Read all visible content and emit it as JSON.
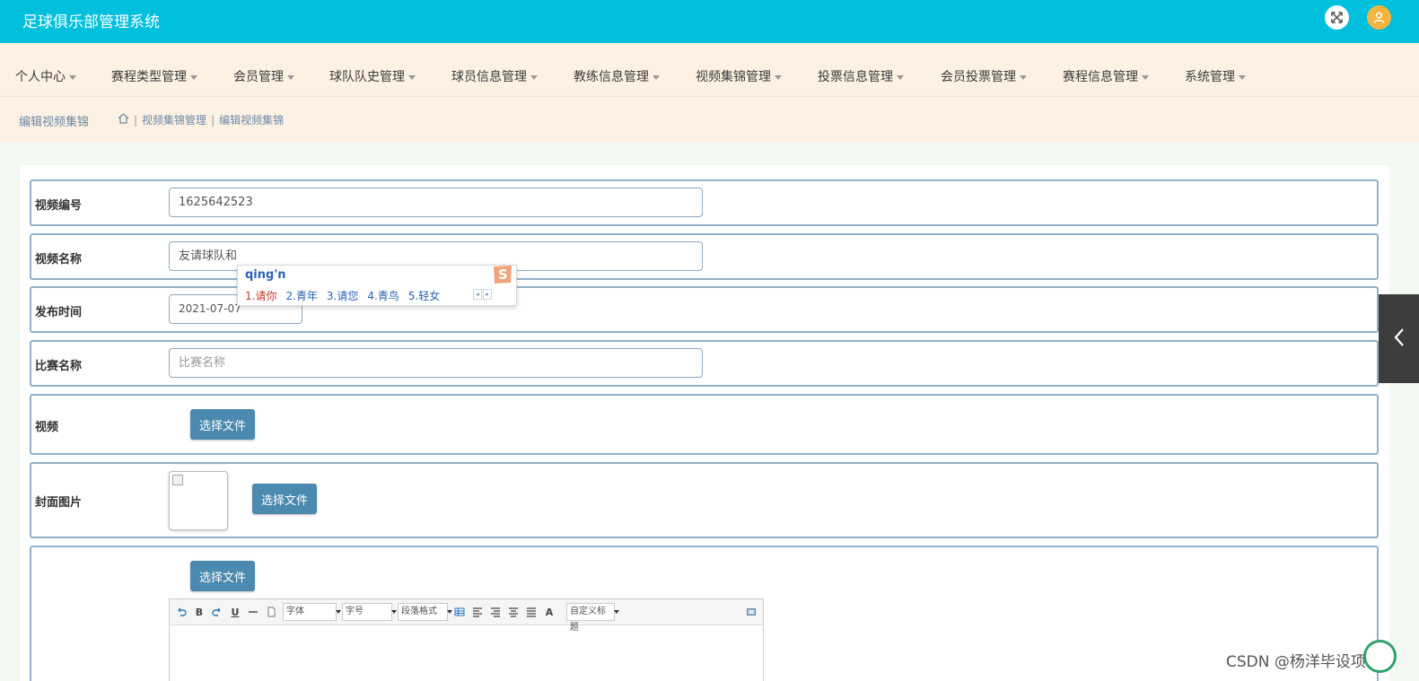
{
  "header": {
    "title": "足球俱乐部管理系统"
  },
  "nav": {
    "items": [
      {
        "label": "个人中心"
      },
      {
        "label": "赛程类型管理"
      },
      {
        "label": "会员管理"
      },
      {
        "label": "球队队史管理"
      },
      {
        "label": "球员信息管理"
      },
      {
        "label": "教练信息管理"
      },
      {
        "label": "视频集锦管理"
      },
      {
        "label": "投票信息管理"
      },
      {
        "label": "会员投票管理"
      },
      {
        "label": "赛程信息管理"
      },
      {
        "label": "系统管理"
      }
    ]
  },
  "breadcrumb": {
    "page_title": "编辑视频集锦",
    "parent": "视频集锦管理",
    "current": "编辑视频集锦",
    "separator": "|"
  },
  "form": {
    "video_no": {
      "label": "视频编号",
      "value": "1625642523"
    },
    "video_name": {
      "label": "视频名称",
      "value": "友请球队和"
    },
    "publish_time": {
      "label": "发布时间",
      "value": "2021-07-07"
    },
    "match_name": {
      "label": "比赛名称",
      "placeholder": "比赛名称"
    },
    "video": {
      "label": "视频",
      "button": "选择文件"
    },
    "cover": {
      "label": "封面图片",
      "button": "选择文件"
    },
    "content": {
      "button": "选择文件"
    }
  },
  "editor": {
    "toolbar": {
      "bold": "B",
      "underline": "U",
      "font_family": "字体",
      "font_size": "字号",
      "paragraph": "段落格式",
      "font_color": "A",
      "custom_title": "自定义标题"
    }
  },
  "ime": {
    "pinyin": "qing'n",
    "candidates": [
      "1.请你",
      "2.青年",
      "3.请您",
      "4.青鸟",
      "5.轻女"
    ],
    "logo_letter": "S"
  },
  "watermark": "CSDN @杨洋毕设项目",
  "colors": {
    "header_bg": "#00c0de",
    "nav_bg": "#fdf1e3",
    "button_bg": "#4b8aae",
    "row_border": "#8fb2cc",
    "user_icon_bg": "#f5b43e"
  },
  "icons": {
    "fullscreen": "expand-arrows-icon",
    "user": "user-avatar-icon",
    "home": "home-icon",
    "side": "chevron-left-icon"
  }
}
